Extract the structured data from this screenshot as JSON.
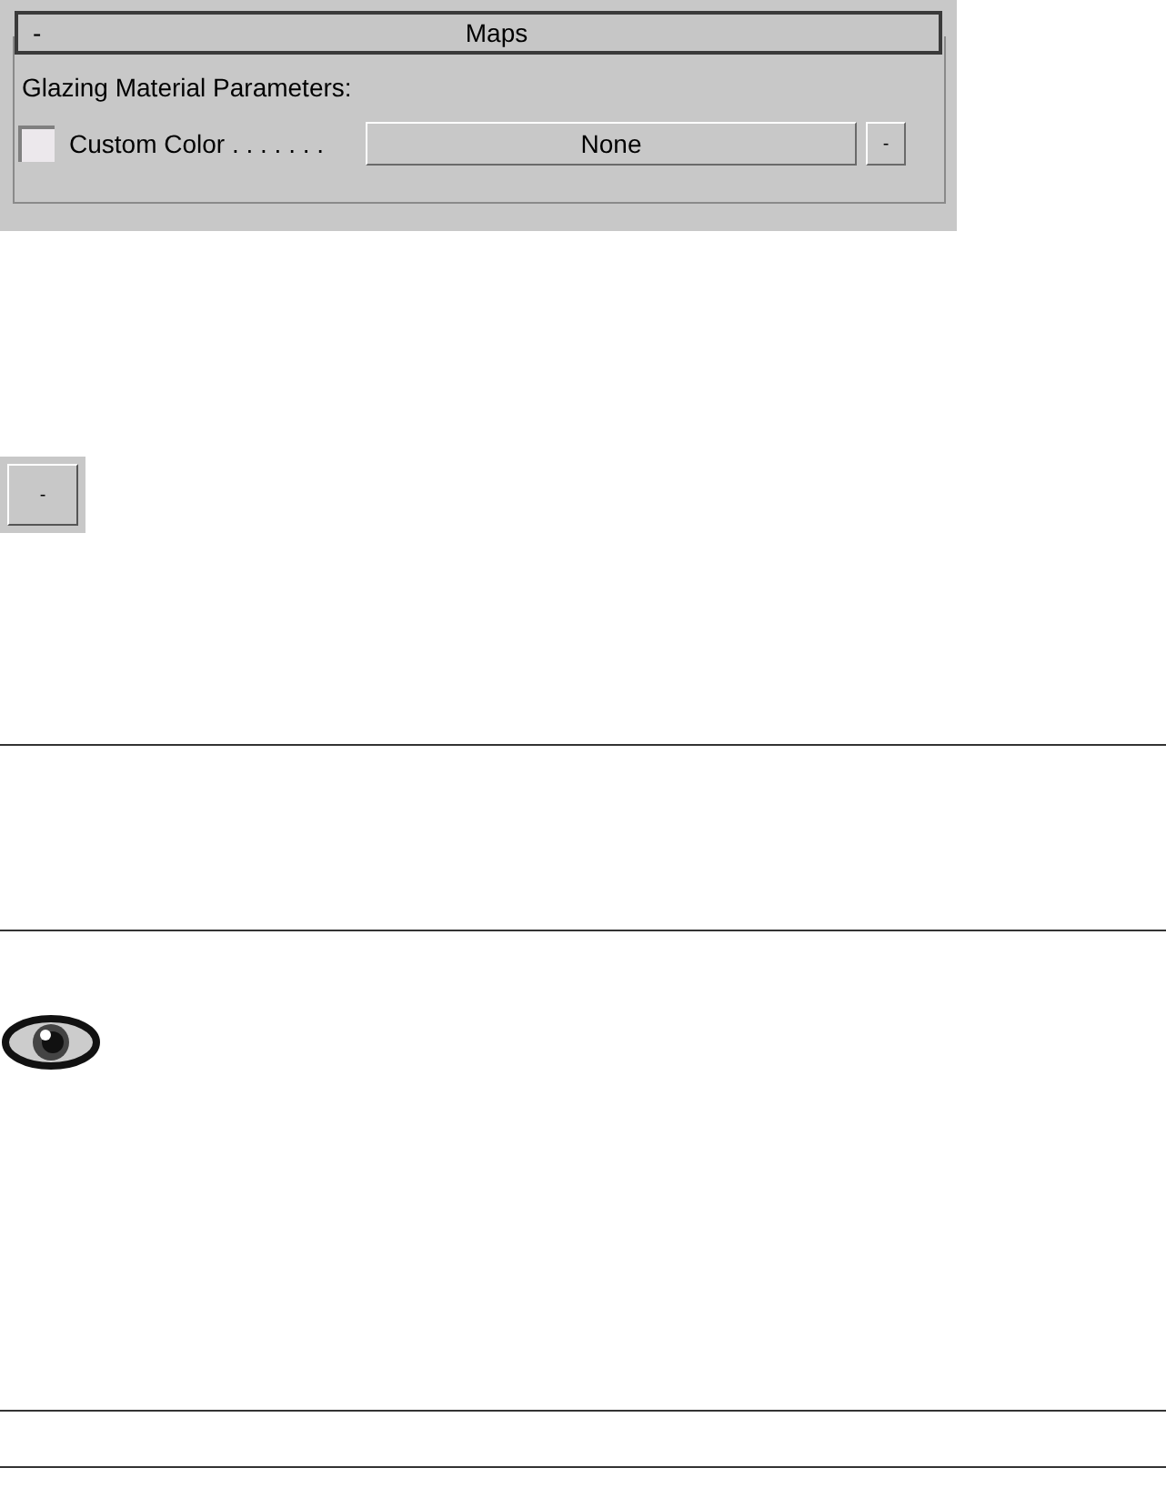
{
  "rollout": {
    "toggle": "-",
    "title": "Maps",
    "group_label": "Glazing Material Parameters:",
    "custom_color": {
      "label": "Custom Color . . . . . . .",
      "checked": false
    },
    "map_button": "None",
    "small_button": "-"
  },
  "standalone_button": "-"
}
